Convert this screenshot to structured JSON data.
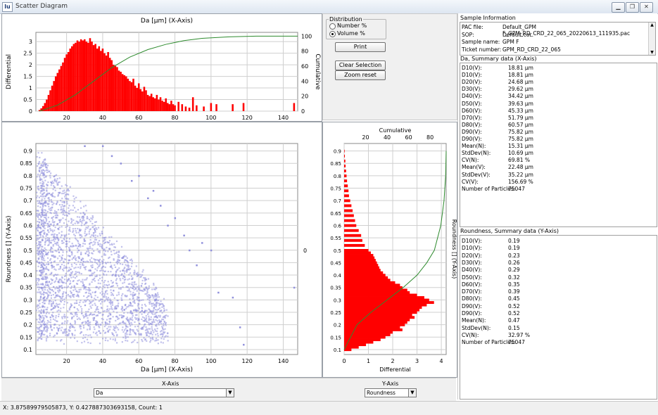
{
  "window": {
    "title": "Scatter Diagram",
    "app_icon": "lu"
  },
  "controls": {
    "distribution_label": "Distribution",
    "number_label": "Number %",
    "volume_label": "Volume %",
    "selected": "Volume %",
    "print_label": "Print",
    "clear_label": "Clear Selection",
    "zoom_label": "Zoom reset"
  },
  "sample_info": {
    "header": "Sample Information",
    "rows": [
      {
        "label": "PAC file:",
        "value": "Default_GPM F_GPM_RD_CRD_22_065_20220613_111935.pac"
      },
      {
        "label": "SOP:",
        "value": "Default.cor"
      },
      {
        "label": "Sample name:",
        "value": "GPM F"
      },
      {
        "label": "Ticket number:",
        "value": "GPM_RD_CRD_22_065"
      }
    ]
  },
  "x_summary": {
    "header": "Da, Summary data (X-Axis)",
    "rows": [
      {
        "label": "D10(V):",
        "value": "18.81 µm"
      },
      {
        "label": "D10(V):",
        "value": "18.81 µm"
      },
      {
        "label": "D20(V):",
        "value": "24.68 µm"
      },
      {
        "label": "D30(V):",
        "value": "29.62 µm"
      },
      {
        "label": "D40(V):",
        "value": "34.42 µm"
      },
      {
        "label": "D50(V):",
        "value": "39.63 µm"
      },
      {
        "label": "D60(V):",
        "value": "45.33 µm"
      },
      {
        "label": "D70(V):",
        "value": "51.79 µm"
      },
      {
        "label": "D80(V):",
        "value": "60.57 µm"
      },
      {
        "label": "D90(V):",
        "value": "75.82 µm"
      },
      {
        "label": "D90(V):",
        "value": "75.82 µm"
      },
      {
        "label": "Mean(N):",
        "value": "15.31 µm"
      },
      {
        "label": "StdDev(N):",
        "value": "10.69 µm"
      },
      {
        "label": "CV(N):",
        "value": "69.81 %"
      },
      {
        "label": "Mean(V):",
        "value": "22.48 µm"
      },
      {
        "label": "StdDev(V):",
        "value": "35.22 µm"
      },
      {
        "label": "CV(V):",
        "value": "156.69 %"
      },
      {
        "label": "Number of Particles:",
        "value": "75047"
      }
    ]
  },
  "y_summary": {
    "header": "Roundness, Summary data (Y-Axis)",
    "rows": [
      {
        "label": "D10(V):",
        "value": "0.19"
      },
      {
        "label": "D10(V):",
        "value": "0.19"
      },
      {
        "label": "D20(V):",
        "value": "0.23"
      },
      {
        "label": "D30(V):",
        "value": "0.26"
      },
      {
        "label": "D40(V):",
        "value": "0.29"
      },
      {
        "label": "D50(V):",
        "value": "0.32"
      },
      {
        "label": "D60(V):",
        "value": "0.35"
      },
      {
        "label": "D70(V):",
        "value": "0.39"
      },
      {
        "label": "D80(V):",
        "value": "0.45"
      },
      {
        "label": "D90(V):",
        "value": "0.52"
      },
      {
        "label": "D90(V):",
        "value": "0.52"
      },
      {
        "label": "Mean(N):",
        "value": "0.47"
      },
      {
        "label": "StdDev(N):",
        "value": "0.15"
      },
      {
        "label": "CV(N):",
        "value": "32.97 %"
      },
      {
        "label": "Number of Particles:",
        "value": "75047"
      }
    ]
  },
  "axis_select": {
    "x_label": "X-Axis",
    "x_value": "Da",
    "y_label": "Y-Axis",
    "y_value": "Roundness"
  },
  "status": "X: 3.87589979505873, Y: 0.427887303693158, Count: 1",
  "colors": {
    "histogram": "#ff0000",
    "cumulative": "#2e8b2e",
    "scatter": "#9090dc",
    "grid": "#cfcfcf"
  },
  "chart_data": [
    {
      "type": "bar",
      "title": "Da [µm] (X-Axis)",
      "ylabel": "Differential",
      "y2label": "Cumulative",
      "xlim": [
        3,
        148
      ],
      "ylim": [
        0,
        3.4
      ],
      "y2lim": [
        0,
        105
      ],
      "xticks": [
        20,
        40,
        60,
        80,
        100,
        120,
        140
      ],
      "yticks": [
        0,
        0.5,
        1,
        1.5,
        2,
        2.5,
        3
      ],
      "y2ticks": [
        0,
        20,
        40,
        60,
        80,
        100
      ],
      "bars_x": [
        5,
        6,
        7,
        8,
        9,
        10,
        11,
        12,
        13,
        14,
        15,
        16,
        17,
        18,
        19,
        20,
        21,
        22,
        23,
        24,
        25,
        26,
        27,
        28,
        29,
        30,
        31,
        32,
        33,
        34,
        35,
        36,
        37,
        38,
        39,
        40,
        41,
        42,
        43,
        44,
        45,
        46,
        47,
        48,
        49,
        50,
        51,
        52,
        53,
        54,
        55,
        56,
        57,
        58,
        59,
        60,
        61,
        62,
        63,
        64,
        65,
        66,
        67,
        68,
        69,
        70,
        71,
        72,
        73,
        74,
        75,
        76,
        77,
        78,
        79,
        80,
        82,
        84,
        86,
        88,
        90,
        92,
        96,
        100,
        103,
        112,
        118,
        146
      ],
      "bars_y": [
        0.05,
        0.12,
        0.22,
        0.35,
        0.5,
        0.7,
        0.9,
        1.1,
        1.3,
        1.5,
        1.65,
        1.8,
        1.95,
        2.1,
        2.3,
        2.45,
        2.55,
        2.7,
        2.8,
        2.9,
        2.95,
        3.05,
        3.0,
        3.1,
        3.05,
        3.1,
        3.0,
        2.95,
        3.15,
        3.0,
        2.85,
        2.9,
        2.7,
        2.8,
        2.6,
        2.7,
        2.5,
        2.4,
        2.55,
        2.3,
        2.2,
        2.0,
        1.95,
        1.9,
        1.75,
        1.7,
        1.6,
        1.55,
        1.5,
        1.4,
        1.3,
        1.25,
        1.4,
        1.1,
        1.0,
        1.2,
        0.95,
        0.85,
        1.05,
        0.9,
        0.7,
        0.65,
        0.75,
        0.6,
        0.55,
        0.7,
        0.5,
        0.6,
        0.45,
        0.4,
        0.55,
        0.35,
        0.3,
        0.45,
        0.3,
        0.25,
        0.4,
        0.3,
        0.2,
        0.15,
        0.6,
        0.25,
        0.2,
        0.35,
        0.3,
        0.3,
        0.35,
        0.35
      ],
      "cumulative_x": [
        5,
        15,
        25,
        35,
        45,
        55,
        65,
        75,
        85,
        95,
        110,
        125,
        148
      ],
      "cumulative_y": [
        0,
        8,
        22,
        40,
        58,
        72,
        82,
        89,
        94,
        97,
        99,
        100,
        100
      ]
    },
    {
      "type": "scatter",
      "xlabel": "Da [µm] (X-Axis)",
      "ylabel": "Roundness [] (Y-Axis)",
      "xlim": [
        3,
        148
      ],
      "ylim": [
        0.08,
        0.93
      ],
      "xticks": [
        20,
        40,
        60,
        80,
        100,
        120,
        140
      ],
      "yticks": [
        0.1,
        0.15,
        0.2,
        0.25,
        0.3,
        0.35,
        0.4,
        0.45,
        0.5,
        0.55,
        0.6,
        0.65,
        0.7,
        0.75,
        0.8,
        0.85,
        0.9
      ],
      "density_note": "Dense cloud concentrated at Da 3–40, Roundness 0.15–0.9; sparse outliers to Da ≈ 145.",
      "outliers": [
        [
          146,
          0.35
        ],
        [
          118,
          0.12
        ],
        [
          116,
          0.19
        ],
        [
          112,
          0.31
        ],
        [
          104,
          0.33
        ],
        [
          100,
          0.5
        ],
        [
          95,
          0.53
        ],
        [
          92,
          0.44
        ],
        [
          88,
          0.5
        ],
        [
          85,
          0.56
        ],
        [
          80,
          0.63
        ],
        [
          76,
          0.6
        ],
        [
          72,
          0.68
        ],
        [
          68,
          0.74
        ],
        [
          65,
          0.71
        ],
        [
          60,
          0.8
        ],
        [
          56,
          0.78
        ],
        [
          50,
          0.85
        ],
        [
          45,
          0.88
        ],
        [
          40,
          0.92
        ],
        [
          30,
          0.92
        ]
      ],
      "right_label": "0"
    },
    {
      "type": "bar",
      "orientation": "horizontal",
      "title": "Cumulative",
      "xlabel": "Differential",
      "ylabel": "Roundness [] (Y-Axis)",
      "xlim": [
        0,
        4.2
      ],
      "ylim": [
        0.08,
        0.93
      ],
      "x2lim": [
        0,
        95
      ],
      "xticks": [
        0,
        1,
        2,
        3,
        4
      ],
      "x2ticks": [
        20,
        40,
        60,
        80
      ],
      "yticks": [
        0.1,
        0.15,
        0.2,
        0.25,
        0.3,
        0.35,
        0.4,
        0.45,
        0.5,
        0.55,
        0.6,
        0.65,
        0.7,
        0.75,
        0.8,
        0.85,
        0.9
      ],
      "bars_y": [
        0.1,
        0.11,
        0.12,
        0.13,
        0.14,
        0.15,
        0.16,
        0.17,
        0.18,
        0.19,
        0.2,
        0.21,
        0.22,
        0.23,
        0.24,
        0.25,
        0.26,
        0.27,
        0.28,
        0.29,
        0.3,
        0.31,
        0.32,
        0.33,
        0.34,
        0.35,
        0.36,
        0.37,
        0.38,
        0.39,
        0.4,
        0.41,
        0.42,
        0.43,
        0.44,
        0.45,
        0.46,
        0.47,
        0.48,
        0.49,
        0.5,
        0.52,
        0.54,
        0.56,
        0.58,
        0.6,
        0.62,
        0.64,
        0.66,
        0.68,
        0.7,
        0.72,
        0.74,
        0.76,
        0.78,
        0.8,
        0.82,
        0.84,
        0.86,
        0.88,
        0.9
      ],
      "bars_x": [
        0.3,
        0.6,
        0.9,
        1.2,
        1.5,
        1.7,
        1.9,
        2.0,
        2.4,
        2.3,
        2.5,
        2.6,
        2.7,
        2.9,
        2.8,
        3.0,
        3.1,
        3.2,
        3.4,
        3.7,
        3.5,
        3.3,
        3.0,
        2.7,
        2.6,
        2.4,
        2.3,
        2.1,
        1.9,
        1.8,
        1.7,
        1.6,
        1.5,
        1.45,
        1.4,
        1.35,
        1.3,
        1.25,
        1.2,
        1.1,
        1.0,
        0.85,
        0.75,
        0.7,
        0.6,
        0.5,
        0.45,
        0.4,
        0.35,
        0.3,
        0.25,
        0.2,
        0.18,
        0.15,
        0.12,
        0.1,
        0.08,
        0.06,
        0.05,
        0.03,
        0.02
      ],
      "cumulative_y": [
        0.1,
        0.2,
        0.25,
        0.3,
        0.35,
        0.4,
        0.45,
        0.5,
        0.6,
        0.7,
        0.8,
        0.9
      ],
      "cumulative_x": [
        0,
        12,
        25,
        40,
        55,
        68,
        77,
        84,
        90,
        93,
        94.5,
        95
      ]
    }
  ]
}
